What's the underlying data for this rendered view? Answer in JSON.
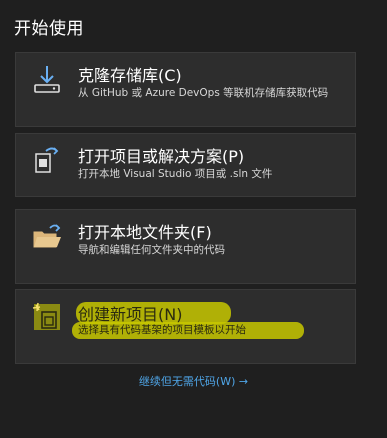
{
  "page": {
    "title": "开始使用"
  },
  "cards": [
    {
      "title": "克隆存储库(C)",
      "description": "从 GitHub 或 Azure DevOps 等联机存储库获取代码",
      "icon": "clone-download-icon"
    },
    {
      "title": "打开项目或解决方案(P)",
      "description": "打开本地 Visual Studio 项目或 .sln 文件",
      "icon": "open-project-icon"
    },
    {
      "title": "打开本地文件夹(F)",
      "description": "导航和编辑任何文件夹中的代码",
      "icon": "open-folder-icon"
    },
    {
      "title": "创建新项目(N)",
      "description": "选择具有代码基架的项目模板以开始",
      "icon": "new-project-icon"
    }
  ],
  "footer": {
    "link": "继续但无需代码(W) →"
  },
  "colors": {
    "highlight": "#c8c800",
    "link": "#4fa6e8",
    "card": "#2d2d2d"
  }
}
